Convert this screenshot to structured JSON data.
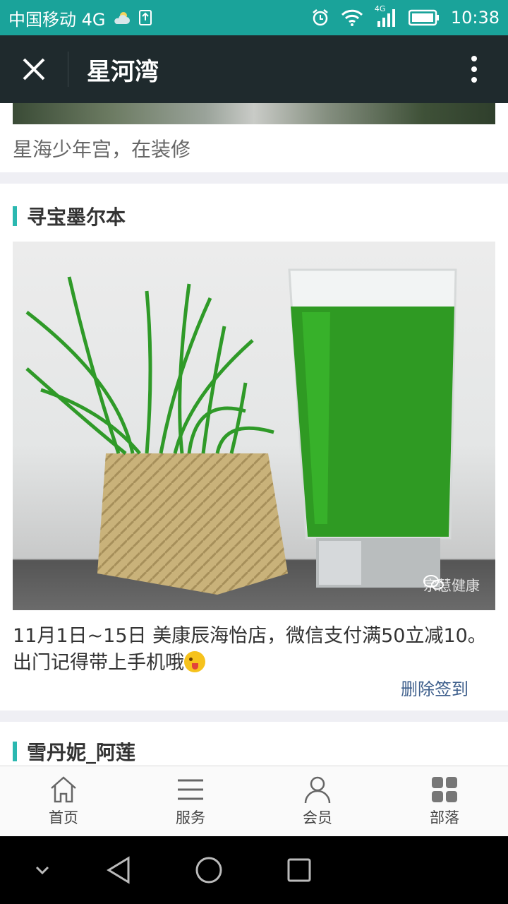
{
  "status_bar": {
    "carrier": "中国移动 4G",
    "time": "10:38",
    "network_badge": "4G"
  },
  "title_bar": {
    "title": "星河湾"
  },
  "posts": [
    {
      "caption": "星海少年宫，在装修"
    },
    {
      "author": "寻宝墨尔本",
      "image_watermark": "宗慧健康",
      "text": "  11月1日~15日  美康辰海怡店，微信支付满50立减10。出门记得带上手机哦",
      "delete_label": "删除签到"
    },
    {
      "author": "雪丹妮_阿莲"
    }
  ],
  "bottom_nav": [
    {
      "label": "首页",
      "icon": "home-icon"
    },
    {
      "label": "服务",
      "icon": "list-icon"
    },
    {
      "label": "会员",
      "icon": "user-icon"
    },
    {
      "label": "部落",
      "icon": "grid-icon"
    }
  ],
  "colors": {
    "status_bar": "#1aa39a",
    "title_bar": "#1f2a2d",
    "accent": "#2bb8b0",
    "link": "#3e5f8c"
  }
}
